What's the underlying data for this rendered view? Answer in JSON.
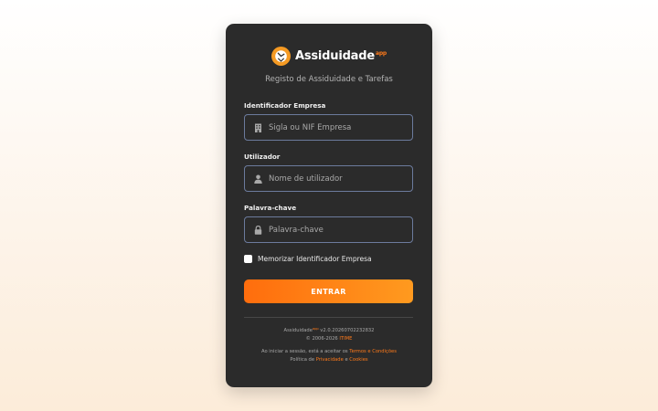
{
  "brand": {
    "name": "Assiduidade",
    "superscript": "app",
    "subtitle": "Registo de Assiduidade e Tarefas"
  },
  "form": {
    "company": {
      "label": "Identificador Empresa",
      "placeholder": "Sigla ou NIF Empresa",
      "value": "",
      "icon": "building-icon"
    },
    "user": {
      "label": "Utilizador",
      "placeholder": "Nome de utilizador",
      "value": "",
      "icon": "user-icon"
    },
    "password": {
      "label": "Palavra-chave",
      "placeholder": "Palavra-chave",
      "value": "",
      "icon": "lock-icon"
    },
    "remember_label": "Memorizar Identificador Empresa",
    "remember_checked": false,
    "submit_label": "ENTRAR"
  },
  "footer": {
    "app_name": "Assiduidade",
    "app_sup": "app",
    "version": " v2.0.20260702232832",
    "copyright_prefix": "© 2006-2026 ",
    "company": "ITIME",
    "terms_prefix": "Ao iniciar a sessão, está a aceitar os ",
    "terms_link": "Termos e Condições",
    "privacy_prefix": "Política de ",
    "privacy_link": "Privacidade",
    "and": " e ",
    "cookies_link": "Cookies"
  },
  "colors": {
    "accent": "#ff7a1a",
    "card": "#2b2b2b",
    "field_border": "#6c7b9d",
    "logo": "#f59a23"
  }
}
